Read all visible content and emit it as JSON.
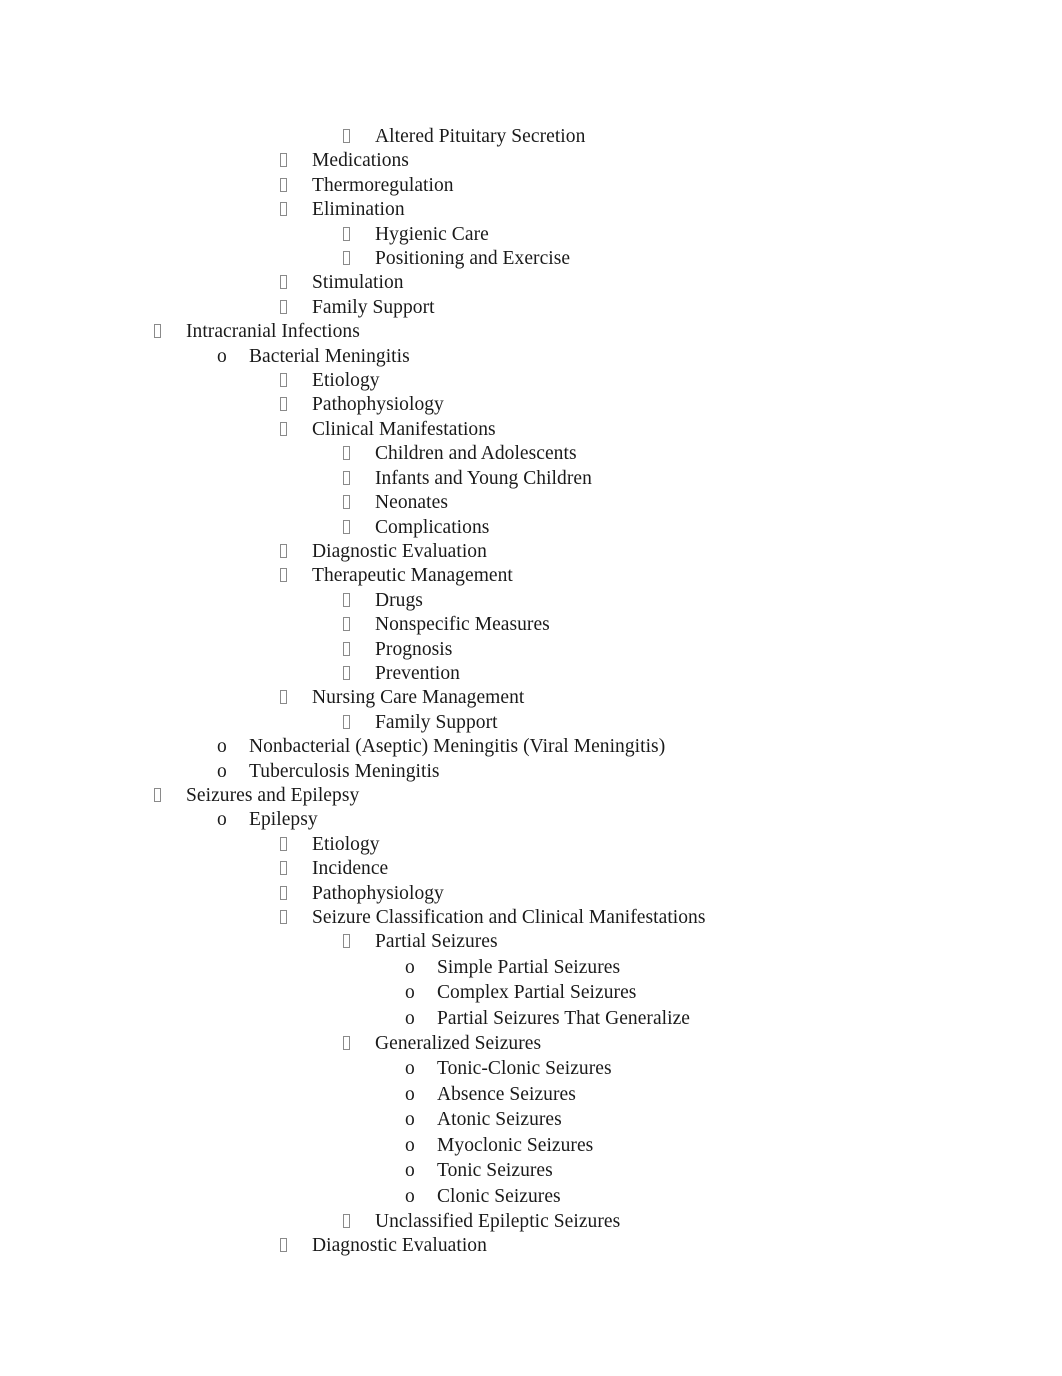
{
  "document": {
    "background_color": "#ffffff",
    "text_color": "#1a1a1a",
    "bullet_box_color": "#8a8a8a",
    "items": [
      {
        "level": 4,
        "marker": "tofu",
        "text": "Altered Pituitary Secretion"
      },
      {
        "level": 3,
        "marker": "tofu",
        "text": "Medications"
      },
      {
        "level": 3,
        "marker": "tofu",
        "text": "Thermoregulation"
      },
      {
        "level": 3,
        "marker": "tofu",
        "text": "Elimination"
      },
      {
        "level": 4,
        "marker": "tofu",
        "text": "Hygienic Care"
      },
      {
        "level": 4,
        "marker": "tofu",
        "text": "Positioning and Exercise"
      },
      {
        "level": 3,
        "marker": "tofu",
        "text": "Stimulation"
      },
      {
        "level": 3,
        "marker": "tofu",
        "text": "Family Support"
      },
      {
        "level": 1,
        "marker": "tofu",
        "text": "Intracranial Infections"
      },
      {
        "level": 2,
        "marker": "circle",
        "text": "Bacterial Meningitis"
      },
      {
        "level": 3,
        "marker": "tofu",
        "text": "Etiology"
      },
      {
        "level": 3,
        "marker": "tofu",
        "text": "Pathophysiology"
      },
      {
        "level": 3,
        "marker": "tofu",
        "text": "Clinical Manifestations"
      },
      {
        "level": 4,
        "marker": "tofu",
        "text": "Children and Adolescents"
      },
      {
        "level": 4,
        "marker": "tofu",
        "text": "Infants and Young Children"
      },
      {
        "level": 4,
        "marker": "tofu",
        "text": "Neonates"
      },
      {
        "level": 4,
        "marker": "tofu",
        "text": "Complications"
      },
      {
        "level": 3,
        "marker": "tofu",
        "text": "Diagnostic Evaluation"
      },
      {
        "level": 3,
        "marker": "tofu",
        "text": "Therapeutic Management"
      },
      {
        "level": 4,
        "marker": "tofu",
        "text": "Drugs"
      },
      {
        "level": 4,
        "marker": "tofu",
        "text": "Nonspecific Measures"
      },
      {
        "level": 4,
        "marker": "tofu",
        "text": "Prognosis"
      },
      {
        "level": 4,
        "marker": "tofu",
        "text": "Prevention"
      },
      {
        "level": 3,
        "marker": "tofu",
        "text": "Nursing Care Management"
      },
      {
        "level": 4,
        "marker": "tofu",
        "text": "Family Support"
      },
      {
        "level": 2,
        "marker": "circle",
        "text": "Nonbacterial (Aseptic) Meningitis (Viral Meningitis)"
      },
      {
        "level": 2,
        "marker": "circle",
        "text": "Tuberculosis Meningitis"
      },
      {
        "level": 1,
        "marker": "tofu",
        "text": "Seizures and Epilepsy"
      },
      {
        "level": 2,
        "marker": "circle",
        "text": "Epilepsy"
      },
      {
        "level": 3,
        "marker": "tofu",
        "text": "Etiology"
      },
      {
        "level": 3,
        "marker": "tofu",
        "text": "Incidence"
      },
      {
        "level": 3,
        "marker": "tofu",
        "text": "Pathophysiology"
      },
      {
        "level": 3,
        "marker": "tofu",
        "text": "Seizure Classification and Clinical Manifestations"
      },
      {
        "level": 4,
        "marker": "tofu",
        "text": "Partial Seizures"
      },
      {
        "level": 5,
        "marker": "circle",
        "text": "Simple Partial Seizures"
      },
      {
        "level": 5,
        "marker": "circle",
        "text": "Complex Partial Seizures"
      },
      {
        "level": 5,
        "marker": "circle",
        "text": "Partial Seizures That Generalize"
      },
      {
        "level": 4,
        "marker": "tofu",
        "text": "Generalized Seizures"
      },
      {
        "level": 5,
        "marker": "circle",
        "text": "Tonic-Clonic Seizures"
      },
      {
        "level": 5,
        "marker": "circle",
        "text": "Absence Seizures"
      },
      {
        "level": 5,
        "marker": "circle",
        "text": "Atonic Seizures"
      },
      {
        "level": 5,
        "marker": "circle",
        "text": "Myoclonic Seizures"
      },
      {
        "level": 5,
        "marker": "circle",
        "text": "Tonic Seizures"
      },
      {
        "level": 5,
        "marker": "circle",
        "text": "Clonic Seizures"
      },
      {
        "level": 4,
        "marker": "tofu",
        "text": "Unclassified Epileptic Seizures"
      },
      {
        "level": 3,
        "marker": "tofu",
        "text": "Diagnostic Evaluation"
      }
    ],
    "marker_glyphs": {
      "tofu": "",
      "circle": "o"
    }
  }
}
